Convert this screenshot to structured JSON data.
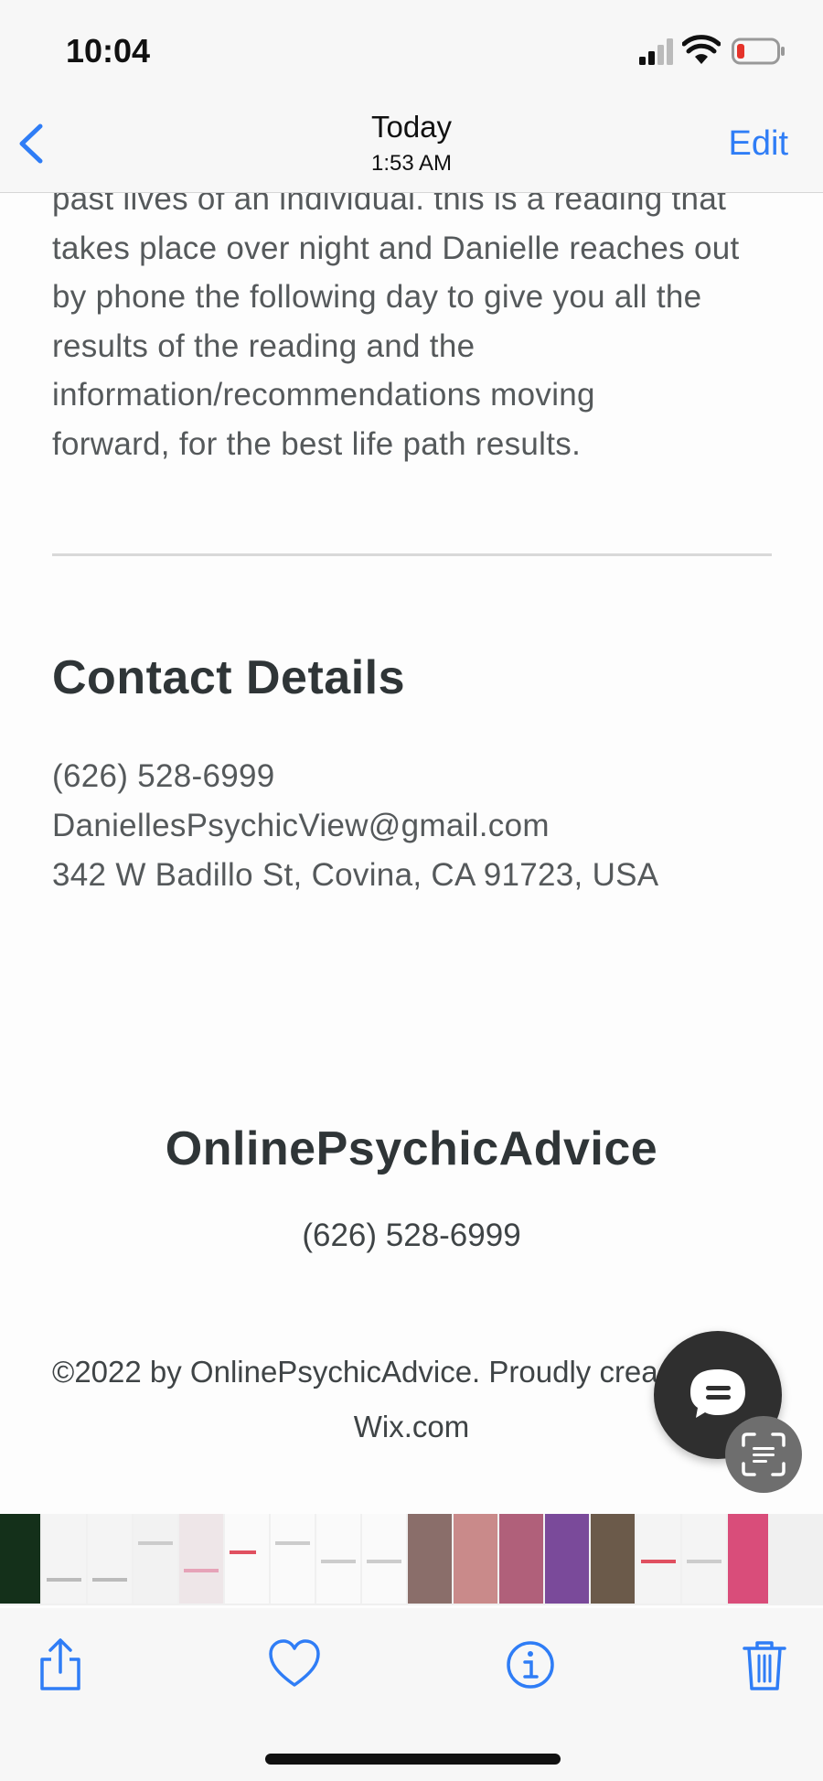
{
  "status_bar": {
    "time": "10:04"
  },
  "nav": {
    "title": "Today",
    "subtitle": "1:53 AM",
    "edit_label": "Edit"
  },
  "content": {
    "description_lines": [
      "past lives of an individual. this is a reading that",
      "takes place over night and Danielle reaches out",
      "by phone the following day to give you all the",
      "results of the reading and the",
      "information/recommendations moving",
      "forward, for the best life path results."
    ],
    "contact_heading": "Contact Details",
    "phone": "(626) 528-6999",
    "email": "DaniellesPsychicView@gmail.com",
    "address": "342 W Badillo St, Covina, CA 91723, USA",
    "brand": "OnlinePsychicAdvice",
    "footer_phone": "(626) 528-6999",
    "copyright_line1": "©2022 by OnlinePsychicAdvice. Proudly crea",
    "copyright_line2": "Wix.com"
  },
  "icons": {
    "back": "chevron-left-icon",
    "chat": "chat-bubble-icon",
    "scan": "live-text-scan-icon",
    "share": "share-icon",
    "favorite": "heart-icon",
    "info": "info-icon",
    "delete": "trash-icon"
  },
  "colors": {
    "accent": "#2f7df6",
    "text": "#3f4446",
    "heading": "#2f3537"
  }
}
